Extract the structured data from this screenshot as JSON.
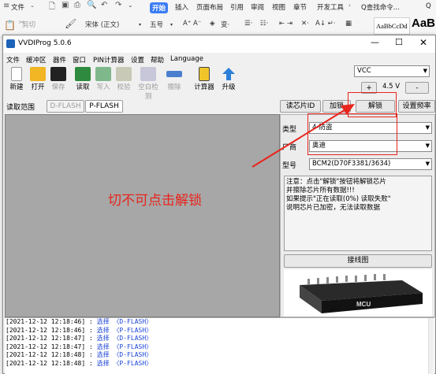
{
  "wps": {
    "menu_file": "文件",
    "tabs": [
      {
        "label": "开始",
        "active": true
      },
      {
        "label": "插入"
      },
      {
        "label": "页面布局"
      },
      {
        "label": "引用"
      },
      {
        "label": "审阅"
      },
      {
        "label": "视图"
      },
      {
        "label": "章节"
      },
      {
        "label": "开发工具"
      }
    ],
    "search_label": "Q查找命令...",
    "cut_label": "剪切",
    "font_name": "宋体 (正文)",
    "font_size": "五号",
    "style1_sample": "AaBbCcDd",
    "style2_sample": "AaB"
  },
  "app": {
    "title": "VVDIProg 5.0.6",
    "menu": [
      "文件",
      "缓冲区",
      "器件",
      "窗口",
      "PIN计算器",
      "设置",
      "帮助",
      "Language"
    ],
    "toolbar": [
      {
        "label": "新建",
        "icon": "new-file-icon",
        "enabled": true
      },
      {
        "label": "打开",
        "icon": "folder-icon",
        "enabled": true
      },
      {
        "label": "保存",
        "icon": "save-icon",
        "enabled": false
      },
      {
        "label": "读取",
        "icon": "read-chip-icon",
        "enabled": true
      },
      {
        "label": "写入",
        "icon": "write-chip-icon",
        "enabled": false
      },
      {
        "label": "校验",
        "icon": "verify-icon",
        "enabled": false
      },
      {
        "label": "空白检测",
        "icon": "blank-check-icon",
        "enabled": false
      },
      {
        "label": "擦除",
        "icon": "erase-icon",
        "enabled": false
      },
      {
        "label": "计算器",
        "icon": "calculator-icon",
        "enabled": true
      },
      {
        "label": "升级",
        "icon": "upgrade-arrow-icon",
        "enabled": true
      }
    ],
    "vcc_value": "VCC",
    "plus_label": "+",
    "voltage": "4.5 V",
    "minus_label": "-",
    "read_range_label": "读取范围",
    "range_tabs": [
      {
        "label": "D-FLASH",
        "enabled": false
      },
      {
        "label": "P-FLASH",
        "enabled": true
      }
    ],
    "action_buttons": [
      "读芯片ID",
      "加锁",
      "解锁",
      "设置频率"
    ],
    "type_label": "类型",
    "type_value": "4-防盗",
    "maker_label": "厂商",
    "maker_value": "奥迪",
    "model_label": "型号",
    "model_value": "BCM2(D70F3381/3634)",
    "note_lines": [
      "注意：点击\"解锁\"按钮将解锁芯片",
      "并擦除芯片所有数据!!!",
      "如果提示\"正在读取(0%) 读取失败\"",
      "说明芯片已加密，无法读取数据"
    ],
    "wiring_button": "接线图",
    "mcu_label": "MCU",
    "log": [
      {
        "time": "[2021-12-12 12:18:46]",
        "text": "选择 〈D-FLASH〉"
      },
      {
        "time": "[2021-12-12 12:18:46]",
        "text": "选择 〈P-FLASH〉"
      },
      {
        "time": "[2021-12-12 12:18:47]",
        "text": "选择 〈D-FLASH〉"
      },
      {
        "time": "[2021-12-12 12:18:47]",
        "text": "选择 〈P-FLASH〉"
      },
      {
        "time": "[2021-12-12 12:18:48]",
        "text": "选择 〈D-FLASH〉"
      },
      {
        "time": "[2021-12-12 12:18:48]",
        "text": "选择 〈P-FLASH〉"
      }
    ]
  },
  "annotation": {
    "text": "切不可点击解锁",
    "color": "#e8241c"
  }
}
